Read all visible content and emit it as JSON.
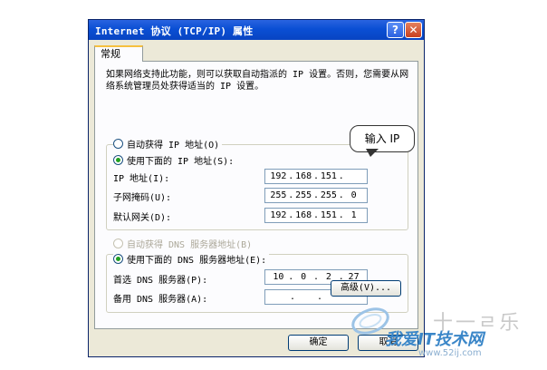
{
  "window": {
    "title": "Internet 协议 (TCP/IP) 属性",
    "help_glyph": "?",
    "close_glyph": "✕"
  },
  "tabs": [
    {
      "label": "常规"
    }
  ],
  "intro_text": "如果网络支持此功能，则可以获取自动指派的 IP 设置。否则，您需要从网络系统管理员处获得适当的 IP 设置。",
  "ip_settings": {
    "auto_ip_label": "自动获得 IP 地址(O)",
    "auto_ip_selected": false,
    "manual_ip_label": "使用下面的 IP 地址(S):",
    "manual_ip_selected": true,
    "fields": [
      {
        "label": "IP 地址(I):",
        "octets": [
          "192",
          "168",
          "151",
          ""
        ]
      },
      {
        "label": "子网掩码(U):",
        "octets": [
          "255",
          "255",
          "255",
          "0"
        ]
      },
      {
        "label": "默认网关(D):",
        "octets": [
          "192",
          "168",
          "151",
          "1"
        ]
      }
    ]
  },
  "dns_settings": {
    "auto_dns_label": "自动获得 DNS 服务器地址(B)",
    "auto_dns_enabled": false,
    "manual_dns_label": "使用下面的 DNS 服务器地址(E):",
    "manual_dns_selected": true,
    "fields": [
      {
        "label": "首选 DNS 服务器(P):",
        "octets": [
          "10",
          "0",
          "2",
          "27"
        ]
      },
      {
        "label": "备用 DNS 服务器(A):",
        "octets": [
          "",
          "",
          "",
          ""
        ]
      }
    ]
  },
  "buttons": {
    "advanced": "高级(V)...",
    "ok": "确定",
    "cancel": "取消"
  },
  "annotation": {
    "text": "输入 IP"
  },
  "watermark": {
    "logo": "十一ㄹ乐",
    "site_name": "我爱IT技术网",
    "url": "www.52ij.com"
  }
}
